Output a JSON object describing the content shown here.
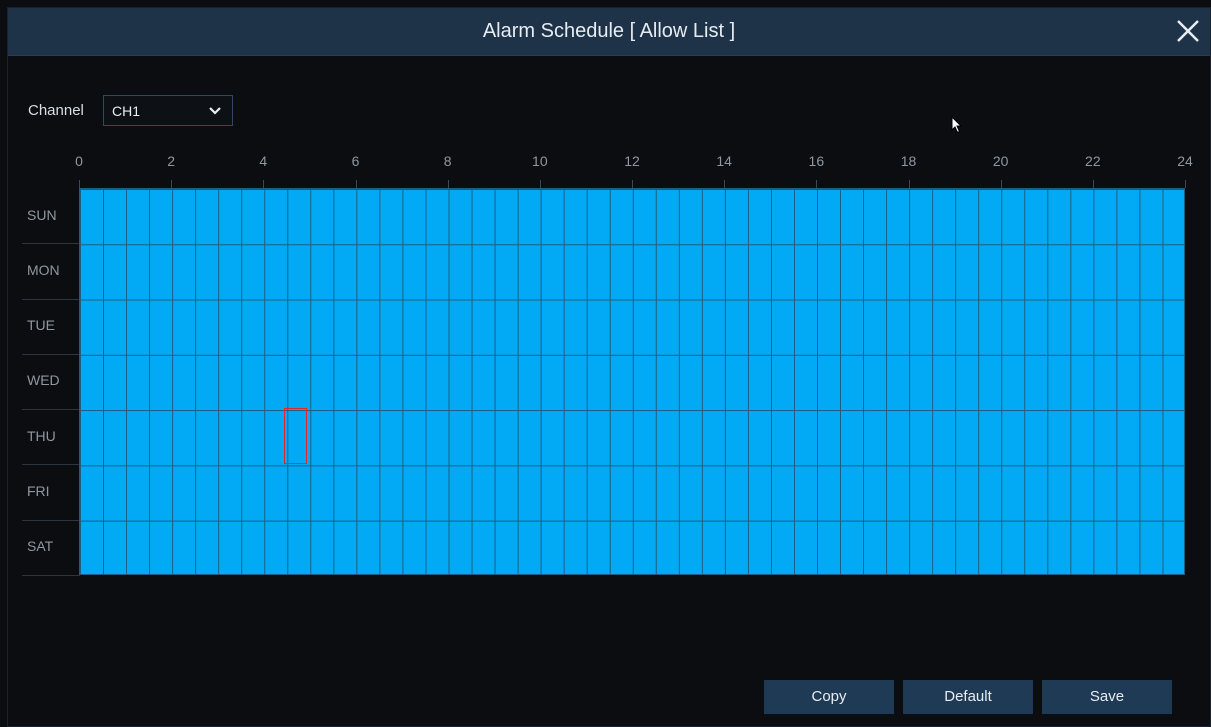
{
  "dialog": {
    "title": "Alarm Schedule [ Allow List ]",
    "close_icon": "close-icon"
  },
  "channel": {
    "label": "Channel",
    "selected": "CH1",
    "dropdown_icon": "chevron-down-icon"
  },
  "schedule": {
    "hour_labels": [
      "0",
      "2",
      "4",
      "6",
      "8",
      "10",
      "12",
      "14",
      "16",
      "18",
      "20",
      "22",
      "24"
    ],
    "days": [
      "SUN",
      "MON",
      "TUE",
      "WED",
      "THU",
      "FRI",
      "SAT"
    ],
    "slots_per_day": 48,
    "all_slots_enabled": true,
    "enabled_color": "#02aaf6",
    "selected_slot": {
      "day": "THU",
      "slot_index": 9
    }
  },
  "buttons": {
    "copy": "Copy",
    "default": "Default",
    "save": "Save"
  },
  "colors": {
    "background": "#0b0d10",
    "titlebar": "#1e3347",
    "button": "#1f3a54",
    "selection": "#e0262e"
  }
}
